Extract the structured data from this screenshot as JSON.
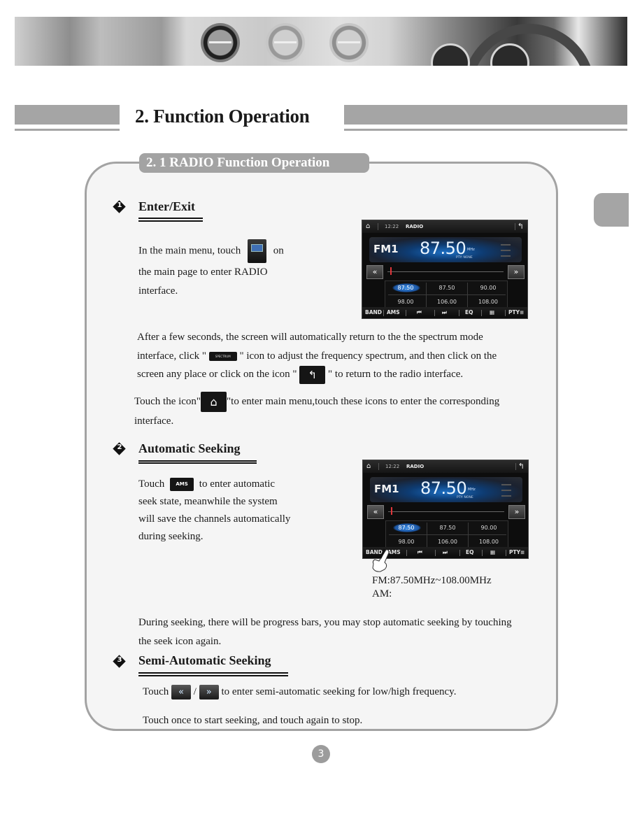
{
  "header": {
    "title": "2. Function Operation",
    "subtitle": "2. 1  RADIO Function Operation"
  },
  "sections": [
    {
      "number": "1",
      "title": "Enter/Exit",
      "paragraph_lines": [
        "In the main menu, touch",
        "on",
        "the main page to enter  RADIO",
        "interface."
      ],
      "after_lines": [
        "After a few seconds, the screen will automatically return to the the spectrum mode",
        "interface, click \"",
        "\" icon to adjust the frequency spectrum, and then click on the",
        "screen any place or click on the icon \"",
        "\" to return to the radio interface."
      ],
      "home_lines": [
        "Touch the icon\"",
        "\"to  enter  main menu,touch these icons to enter the corresponding",
        "interface."
      ],
      "spectrum_icon_label": "SPECTRUM"
    },
    {
      "number": "2",
      "title": "Automatic  Seeking",
      "paragraph_lines": [
        "Touch",
        "to enter automatic",
        "seek state, meanwhile the system",
        "will save the channels automatically",
        "during seeking."
      ],
      "ams_icon_label": "AMS",
      "range_fm": "FM:87.50MHz~108.00MHz",
      "range_am": "AM:",
      "progress_lines": [
        "During seeking, there will be progress bars, you may stop automatic seeking by  touching",
        "the seek icon  again."
      ]
    },
    {
      "number": "3",
      "title": "Semi-Automatic Seeking",
      "line1_a": "Touch",
      "line1_sep": "/",
      "line1_b": "to enter semi-automatic seeking for low/high  frequency.",
      "line2": "Touch once to start seeking, and touch again to stop."
    }
  ],
  "radio_screen": {
    "time": "12:22",
    "label": "RADIO",
    "band": "FM1",
    "frequency": "87.50",
    "unit": "MHz",
    "pty": "PTY:  NONE",
    "presets": [
      "87.50",
      "87.50",
      "90.00",
      "98.00",
      "106.00",
      "108.00"
    ],
    "active_preset": 0,
    "bottom_buttons": [
      "BAND",
      "AMS",
      "⏮",
      "⏭",
      "EQ",
      "▦",
      "PTY≡"
    ]
  },
  "page_number": "3",
  "colors": {
    "header_gray": "#a5a5a5",
    "frame_gray": "#a3a3a3",
    "radio_blue": "#1d6fc3",
    "seek_marker": "#e0353a"
  }
}
